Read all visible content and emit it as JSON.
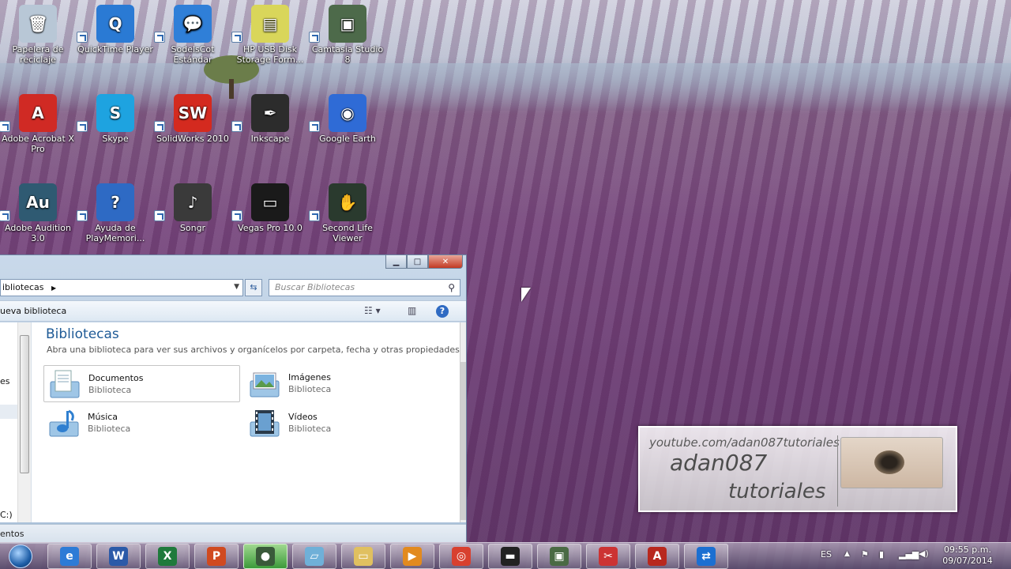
{
  "desktop": {
    "icons": [
      {
        "label": "Papelera de reciclaje",
        "icon": "recycle-bin-icon",
        "color": "#b8c7d6"
      },
      {
        "label": "QuickTime Player",
        "icon": "quicktime-icon",
        "color": "#2a7ad4"
      },
      {
        "label": "SodelsCot Estándar",
        "icon": "chat-bubble-icon",
        "color": "#2f7fd8"
      },
      {
        "label": "HP USB Disk Storage Form...",
        "icon": "hp-usb-icon",
        "color": "#d9d65a"
      },
      {
        "label": "Camtasia Studio 8",
        "icon": "camtasia-icon",
        "color": "#4d6a4a"
      },
      {
        "label": "Adobe Acrobat X Pro",
        "icon": "acrobat-icon",
        "color": "#d02a24"
      },
      {
        "label": "Skype",
        "icon": "skype-icon",
        "color": "#1ea3e0"
      },
      {
        "label": "SolidWorks 2010",
        "icon": "solidworks-icon",
        "color": "#d42a1f"
      },
      {
        "label": "Inkscape",
        "icon": "inkscape-icon",
        "color": "#2c2c2c"
      },
      {
        "label": "Google Earth",
        "icon": "google-earth-icon",
        "color": "#2f6bd6"
      },
      {
        "label": "Adobe Audition 3.0",
        "icon": "audition-icon",
        "color": "#2f5a72"
      },
      {
        "label": "Ayuda de PlayMemori...",
        "icon": "help-icon",
        "color": "#2e6ac4"
      },
      {
        "label": "Songr",
        "icon": "songr-icon",
        "color": "#3a3a3a"
      },
      {
        "label": "Vegas Pro 10.0",
        "icon": "vegas-icon",
        "color": "#1a1a1a"
      },
      {
        "label": "Second Life Viewer",
        "icon": "second-life-icon",
        "color": "#2a3a2e"
      }
    ],
    "glyphs": [
      "🗑",
      "Q",
      "💬",
      "▤",
      "▣",
      "A",
      "S",
      "SW",
      "✒",
      "◉",
      "Au",
      "?",
      "♪",
      "▭",
      "✋"
    ]
  },
  "explorer": {
    "address": "ibliotecas",
    "search_placeholder": "Buscar Bibliotecas",
    "toolbar": {
      "new_library": "ueva biblioteca"
    },
    "nav": {
      "item_partial": "es",
      "drive_partial": "C:)"
    },
    "title": "Bibliotecas",
    "subtitle": "Abra una biblioteca para ver sus archivos y organícelos por carpeta, fecha y otras propiedades.",
    "libraries": [
      {
        "name": "Documentos",
        "kind": "Biblioteca",
        "icon": "documents-library-icon"
      },
      {
        "name": "Imágenes",
        "kind": "Biblioteca",
        "icon": "pictures-library-icon"
      },
      {
        "name": "Música",
        "kind": "Biblioteca",
        "icon": "music-library-icon"
      },
      {
        "name": "Vídeos",
        "kind": "Biblioteca",
        "icon": "videos-library-icon"
      }
    ],
    "status": "entos"
  },
  "watermark": {
    "url": "youtube.com/adan087tutoriales",
    "line1": "adan087",
    "line2": "tutoriales"
  },
  "taskbar": {
    "apps": [
      {
        "name": "internet-explorer",
        "glyph": "e",
        "color": "#2d7bd6"
      },
      {
        "name": "word",
        "glyph": "W",
        "color": "#2b5aa8"
      },
      {
        "name": "excel",
        "glyph": "X",
        "color": "#1f7a3c"
      },
      {
        "name": "powerpoint",
        "glyph": "P",
        "color": "#d04a20"
      },
      {
        "name": "camtasia-recorder",
        "glyph": "●",
        "color": "#3a5a3a"
      },
      {
        "name": "notes",
        "glyph": "▱",
        "color": "#6fb0d8"
      },
      {
        "name": "windows-explorer",
        "glyph": "▭",
        "color": "#e0c060"
      },
      {
        "name": "media-player",
        "glyph": "▶",
        "color": "#e28a1f"
      },
      {
        "name": "chrome",
        "glyph": "◎",
        "color": "#d8402f"
      },
      {
        "name": "vegas",
        "glyph": "▬",
        "color": "#222"
      },
      {
        "name": "camtasia-studio",
        "glyph": "▣",
        "color": "#4a6a44"
      },
      {
        "name": "snipping-tool",
        "glyph": "✂",
        "color": "#c33"
      },
      {
        "name": "autocad",
        "glyph": "A",
        "color": "#b8281e"
      },
      {
        "name": "teamviewer",
        "glyph": "⇄",
        "color": "#1c6fd1"
      }
    ],
    "lang": "ES",
    "time": "09:55 p.m.",
    "date": "09/07/2014"
  }
}
